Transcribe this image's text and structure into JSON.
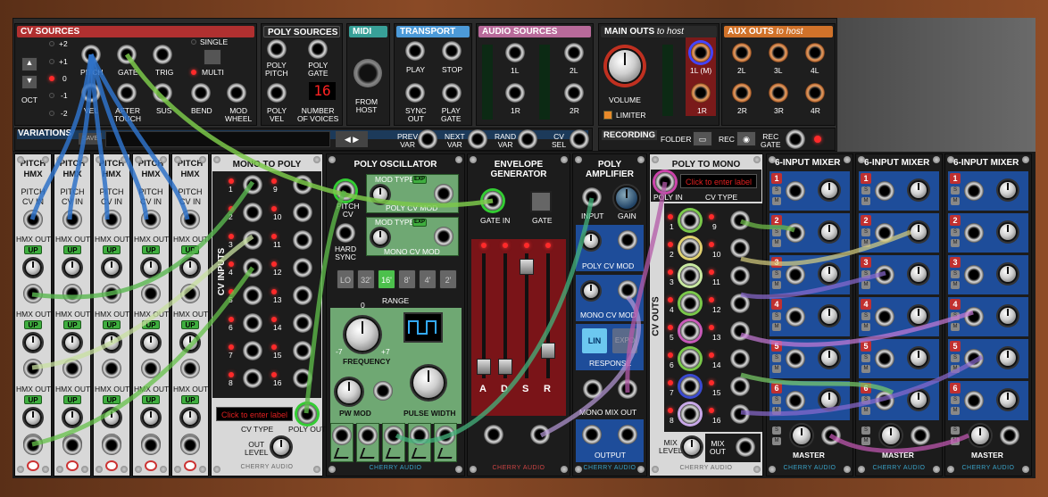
{
  "top": {
    "cv_sources": {
      "title": "CV SOURCES",
      "oct_values": [
        "+2",
        "+1",
        "0",
        "-1",
        "-2"
      ],
      "oct_label": "OCT",
      "pitch": "PITCH",
      "vel": "VEL",
      "gate": "GATE",
      "trig": "TRIG",
      "single": "SINGLE",
      "multi": "MULTI",
      "after_touch": "AFTER\nTOUCH",
      "sus": "SUS",
      "bend": "BEND",
      "mod_wheel": "MOD\nWHEEL"
    },
    "poly_sources": {
      "title": "POLY SOURCES",
      "poly_pitch": "POLY\nPITCH",
      "poly_gate": "POLY\nGATE",
      "poly_vel": "POLY\nVEL",
      "voices_display": "16",
      "number_of_voices": "NUMBER\nOF VOICES"
    },
    "midi": {
      "title": "MIDI",
      "from_host": "FROM\nHOST"
    },
    "transport": {
      "title": "TRANSPORT",
      "play": "PLAY",
      "stop": "STOP",
      "sync_out": "SYNC\nOUT",
      "play_gate": "PLAY\nGATE"
    },
    "audio_sources": {
      "title": "AUDIO SOURCES",
      "l1": "1L",
      "l2": "2L",
      "r1": "1R",
      "r2": "2R"
    },
    "main_outs": {
      "title": "MAIN OUTS",
      "title_suffix": "to host",
      "volume": "VOLUME",
      "limiter": "LIMITER"
    },
    "aux_outs": {
      "title": "AUX OUTS",
      "title_suffix": "to host",
      "labels": [
        "1L (M)",
        "2L",
        "3L",
        "4L",
        "1R",
        "2R",
        "3R",
        "4R"
      ]
    },
    "variations": {
      "title": "VARIATIONS",
      "save": "SAVE",
      "prev": "PREV\nVAR",
      "next": "NEXT\nVAR",
      "rand": "RAND\nVAR",
      "cv_sel": "CV\nSEL"
    },
    "recording": {
      "title": "RECORDING",
      "folder": "FOLDER",
      "rec": "REC",
      "rec_gate": "REC\nGATE"
    }
  },
  "pitch_hmx": {
    "title": "PITCH\nHMX",
    "cv_in": "PITCH\nCV IN",
    "hmx_out": "HMX OUT",
    "up": "UP"
  },
  "mono_to_poly": {
    "title": "MONO TO POLY",
    "cv_inputs": "CV INPUTS",
    "left_nums": [
      "1",
      "2",
      "3",
      "4",
      "5",
      "6",
      "7",
      "8"
    ],
    "right_nums": [
      "9",
      "10",
      "11",
      "12",
      "13",
      "14",
      "15",
      "16"
    ],
    "label_placeholder": "Click to enter label",
    "cv_type": "CV TYPE",
    "poly_out": "POLY OUT",
    "out_level": "OUT\nLEVEL",
    "brand": "CHERRY AUDIO"
  },
  "poly_osc": {
    "title": "POLY OSCILLATOR",
    "pitch_cv": "PITCH\nCV",
    "hard_sync": "HARD\nSYNC",
    "mod_type": "MOD TYPE",
    "exp": "EXP",
    "poly_cv_mod": "POLY CV MOD",
    "mono_cv_mod": "MONO CV MOD",
    "ranges": [
      "LO",
      "32'",
      "16'",
      "8'",
      "4'",
      "2'"
    ],
    "range": "RANGE",
    "frequency": "FREQUENCY",
    "freq_zero": "0",
    "freq_min": "-7",
    "freq_max": "+7",
    "pw_mod": "PW MOD",
    "pulse_width": "PULSE WIDTH",
    "brand": "CHERRY AUDIO"
  },
  "envelope": {
    "title": "ENVELOPE\nGENERATOR",
    "gate_in": "GATE IN",
    "gate": "GATE",
    "sliders": [
      "A",
      "D",
      "S",
      "R"
    ],
    "brand": "CHERRY AUDIO"
  },
  "poly_amp": {
    "title": "POLY\nAMPLIFIER",
    "input": "INPUT",
    "gain": "GAIN",
    "poly_cv_mod": "POLY CV MOD",
    "mono_cv_mod": "MONO CV MOD",
    "lin": "LIN",
    "expo": "EXPO",
    "response": "RESPONSE",
    "mono_mix_out": "MONO MIX OUT",
    "output": "OUTPUT",
    "brand": "CHERRY AUDIO"
  },
  "poly_to_mono": {
    "title": "POLY TO MONO",
    "poly_in": "POLY IN",
    "label_placeholder": "Click to enter label",
    "cv_type": "CV TYPE",
    "cv_outs": "CV OUTS",
    "left_nums": [
      "1",
      "2",
      "3",
      "4",
      "5",
      "6",
      "7",
      "8"
    ],
    "right_nums": [
      "9",
      "10",
      "11",
      "12",
      "13",
      "14",
      "15",
      "16"
    ],
    "mix_level": "MIX\nLEVEL",
    "mix_out": "MIX\nOUT",
    "brand": "CHERRY AUDIO"
  },
  "mixer": {
    "title": "6-INPUT MIXER",
    "channels": [
      "1",
      "2",
      "3",
      "4",
      "5",
      "6"
    ],
    "master": "MASTER",
    "s": "S",
    "m": "M",
    "brand": "CHERRY AUDIO"
  }
}
